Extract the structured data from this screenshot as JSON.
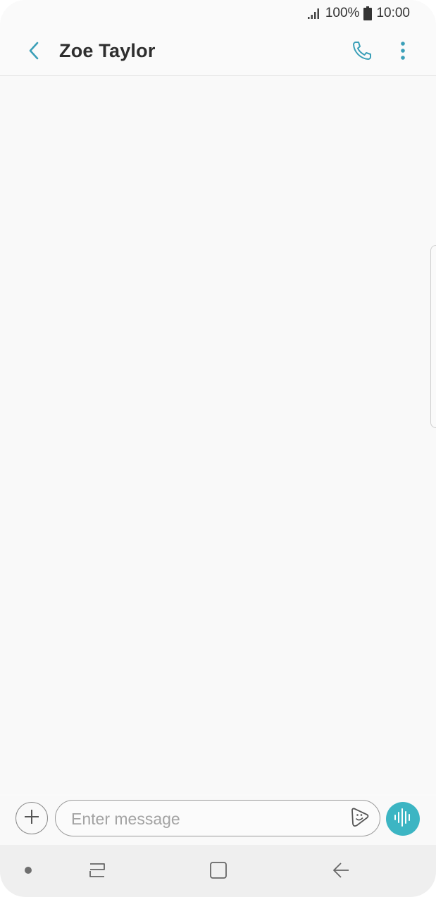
{
  "status_bar": {
    "battery": "100%",
    "time": "10:00"
  },
  "header": {
    "title": "Zoe Taylor",
    "icons": {
      "back": "back-arrow-icon",
      "call": "phone-icon",
      "more": "more-vert-icon"
    }
  },
  "composer": {
    "placeholder": "Enter message",
    "value": "",
    "icons": {
      "add": "plus-icon",
      "sticker": "sticker-icon",
      "voice": "voice-wave-icon"
    }
  },
  "navigation": {
    "icons": [
      "dot-icon",
      "recents-icon",
      "home-icon",
      "back-icon"
    ]
  },
  "colors": {
    "accent": "#3cb5c3",
    "icon_accent": "#3a9fb8",
    "background": "#f9f9f9",
    "nav_background": "#efefef"
  }
}
